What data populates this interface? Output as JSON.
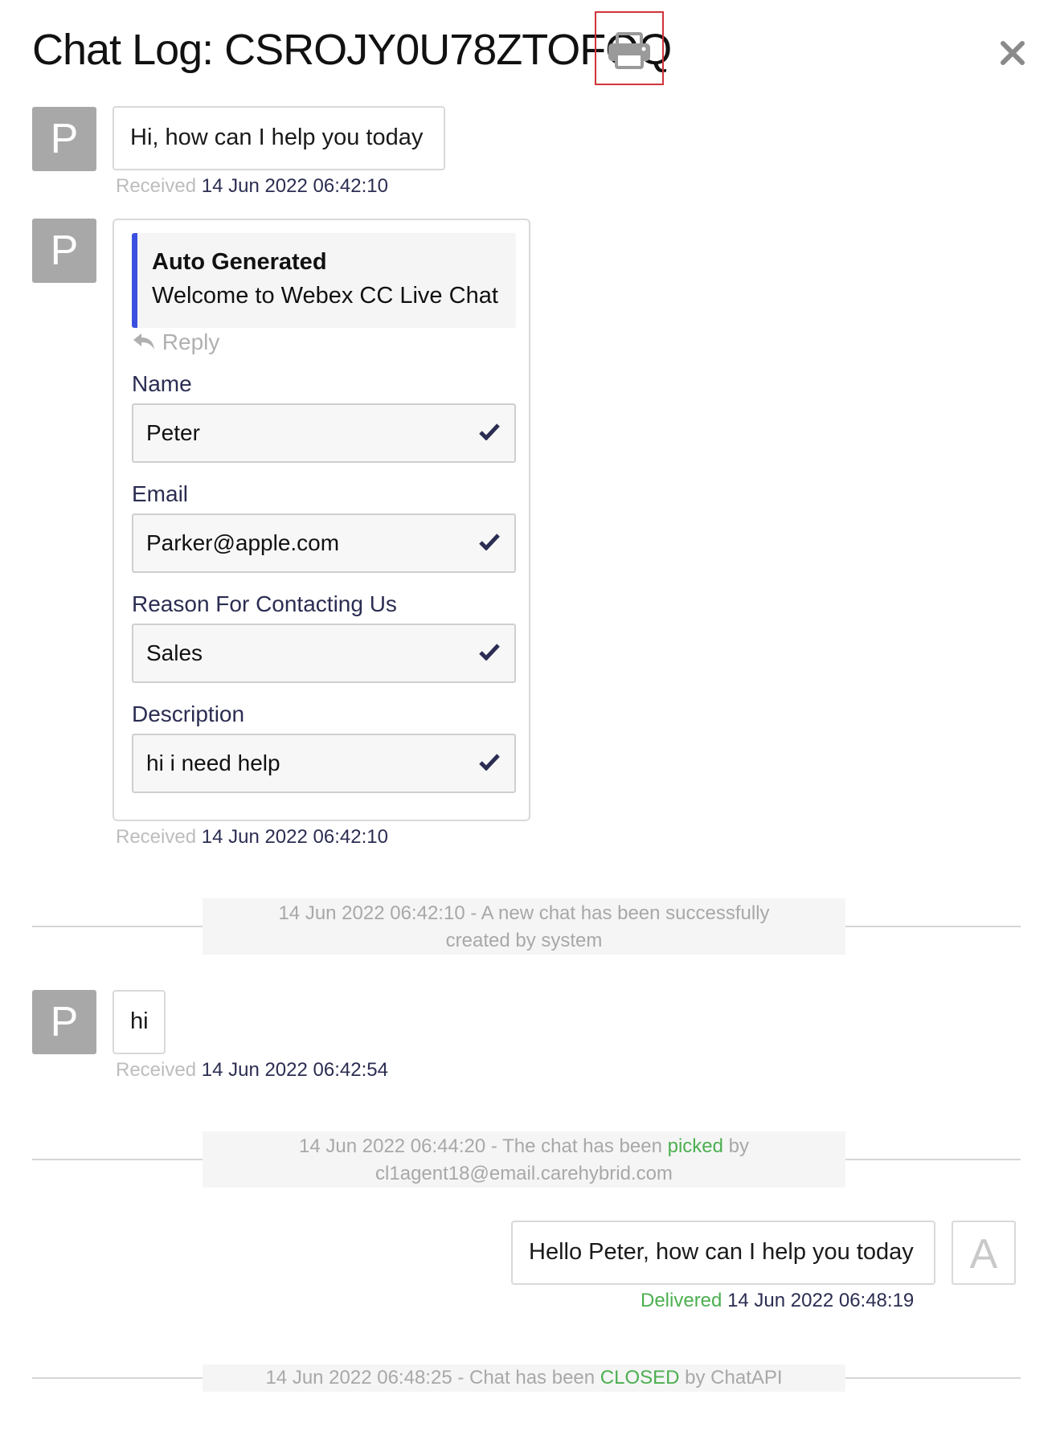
{
  "header": {
    "title": "Chat Log: CSROJY0U78ZTOFOQ",
    "print_icon": "printer-icon",
    "close_icon": "close-icon"
  },
  "messages": [
    {
      "avatar": "P",
      "text": "Hi, how can I help you today",
      "status": "Received",
      "timestamp": "14 Jun 2022 06:42:10"
    },
    {
      "avatar": "P",
      "quote_title": "Auto Generated",
      "quote_body": "Welcome to Webex CC Live Chat",
      "reply_label": "Reply",
      "fields": [
        {
          "label": "Name",
          "value": "Peter"
        },
        {
          "label": "Email",
          "value": "Parker@apple.com"
        },
        {
          "label": "Reason For Contacting Us",
          "value": "Sales"
        },
        {
          "label": "Description",
          "value": "hi i need help"
        }
      ],
      "status": "Received",
      "timestamp": "14 Jun 2022 06:42:10"
    },
    {
      "avatar": "P",
      "text": "hi",
      "status": "Received",
      "timestamp": "14 Jun 2022 06:42:54"
    },
    {
      "avatar": "A",
      "text": "Hello Peter, how can I help you today",
      "status": "Delivered",
      "timestamp": "14 Jun 2022 06:48:19"
    }
  ],
  "system_events": [
    {
      "line1": "14 Jun 2022 06:42:10 - A new chat has been successfully",
      "line2": "created by system"
    },
    {
      "line1_pre": "14 Jun 2022 06:44:20 - The chat has been ",
      "line1_highlight": "picked",
      "line1_post": " by",
      "line2": "cl1agent18@email.carehybrid.com"
    },
    {
      "pre": "14 Jun 2022 06:48:25 - Chat has been ",
      "highlight": "CLOSED",
      "post": " by ChatAPI"
    }
  ],
  "colors": {
    "accent_bar": "#3c50e0",
    "green": "#4caf50",
    "print_highlight": "#d0343a"
  }
}
